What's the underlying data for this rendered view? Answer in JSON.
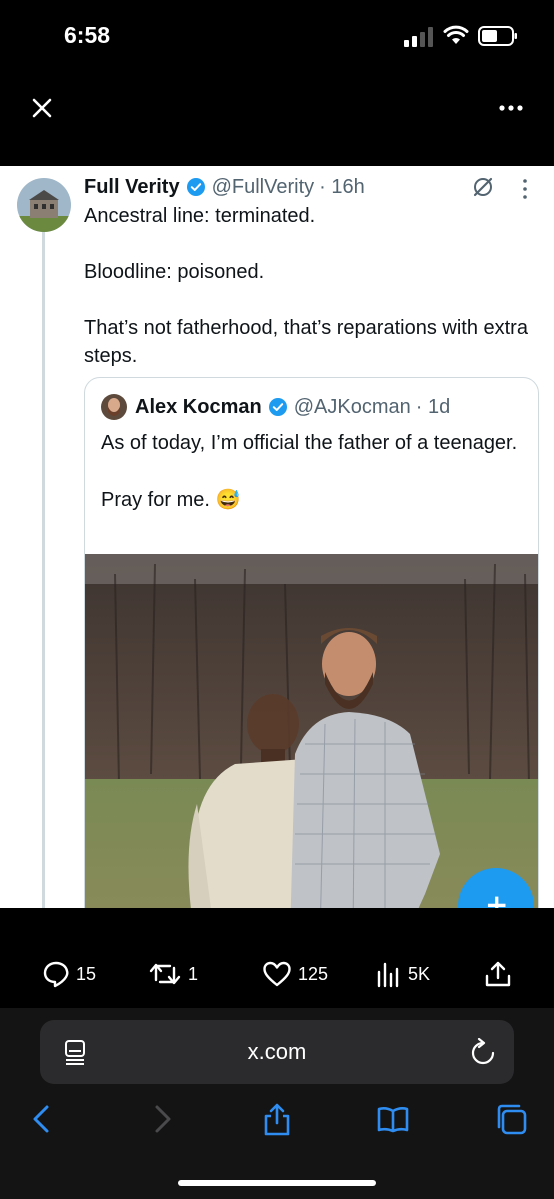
{
  "status": {
    "time": "6:58"
  },
  "tweet": {
    "display_name": "Full Verity",
    "handle": "@FullVerity",
    "time": "· 16h",
    "lines": [
      "Ancestral line: terminated.",
      "Bloodline: poisoned.",
      "That’s not fatherhood, that’s reparations with extra steps."
    ]
  },
  "quote": {
    "display_name": "Alex Kocman",
    "handle": "@AJKocman",
    "time": "· 1d",
    "lines": [
      "As of today, I’m official the father of a teenager.",
      "Pray for me. 😅"
    ]
  },
  "actions": {
    "replies": "15",
    "reposts": "1",
    "likes": "125",
    "views": "5K"
  },
  "browser": {
    "url": "x.com"
  },
  "colors": {
    "accent": "#1d9bf0",
    "background": "#000000",
    "text_secondary": "#536471"
  },
  "icons": [
    "close-icon",
    "more-icon",
    "verified-icon",
    "grok-icon",
    "reply-icon",
    "repost-icon",
    "like-icon",
    "views-icon",
    "share-icon",
    "reload-icon",
    "back-icon",
    "forward-icon",
    "bookmarks-icon",
    "tabs-icon"
  ]
}
